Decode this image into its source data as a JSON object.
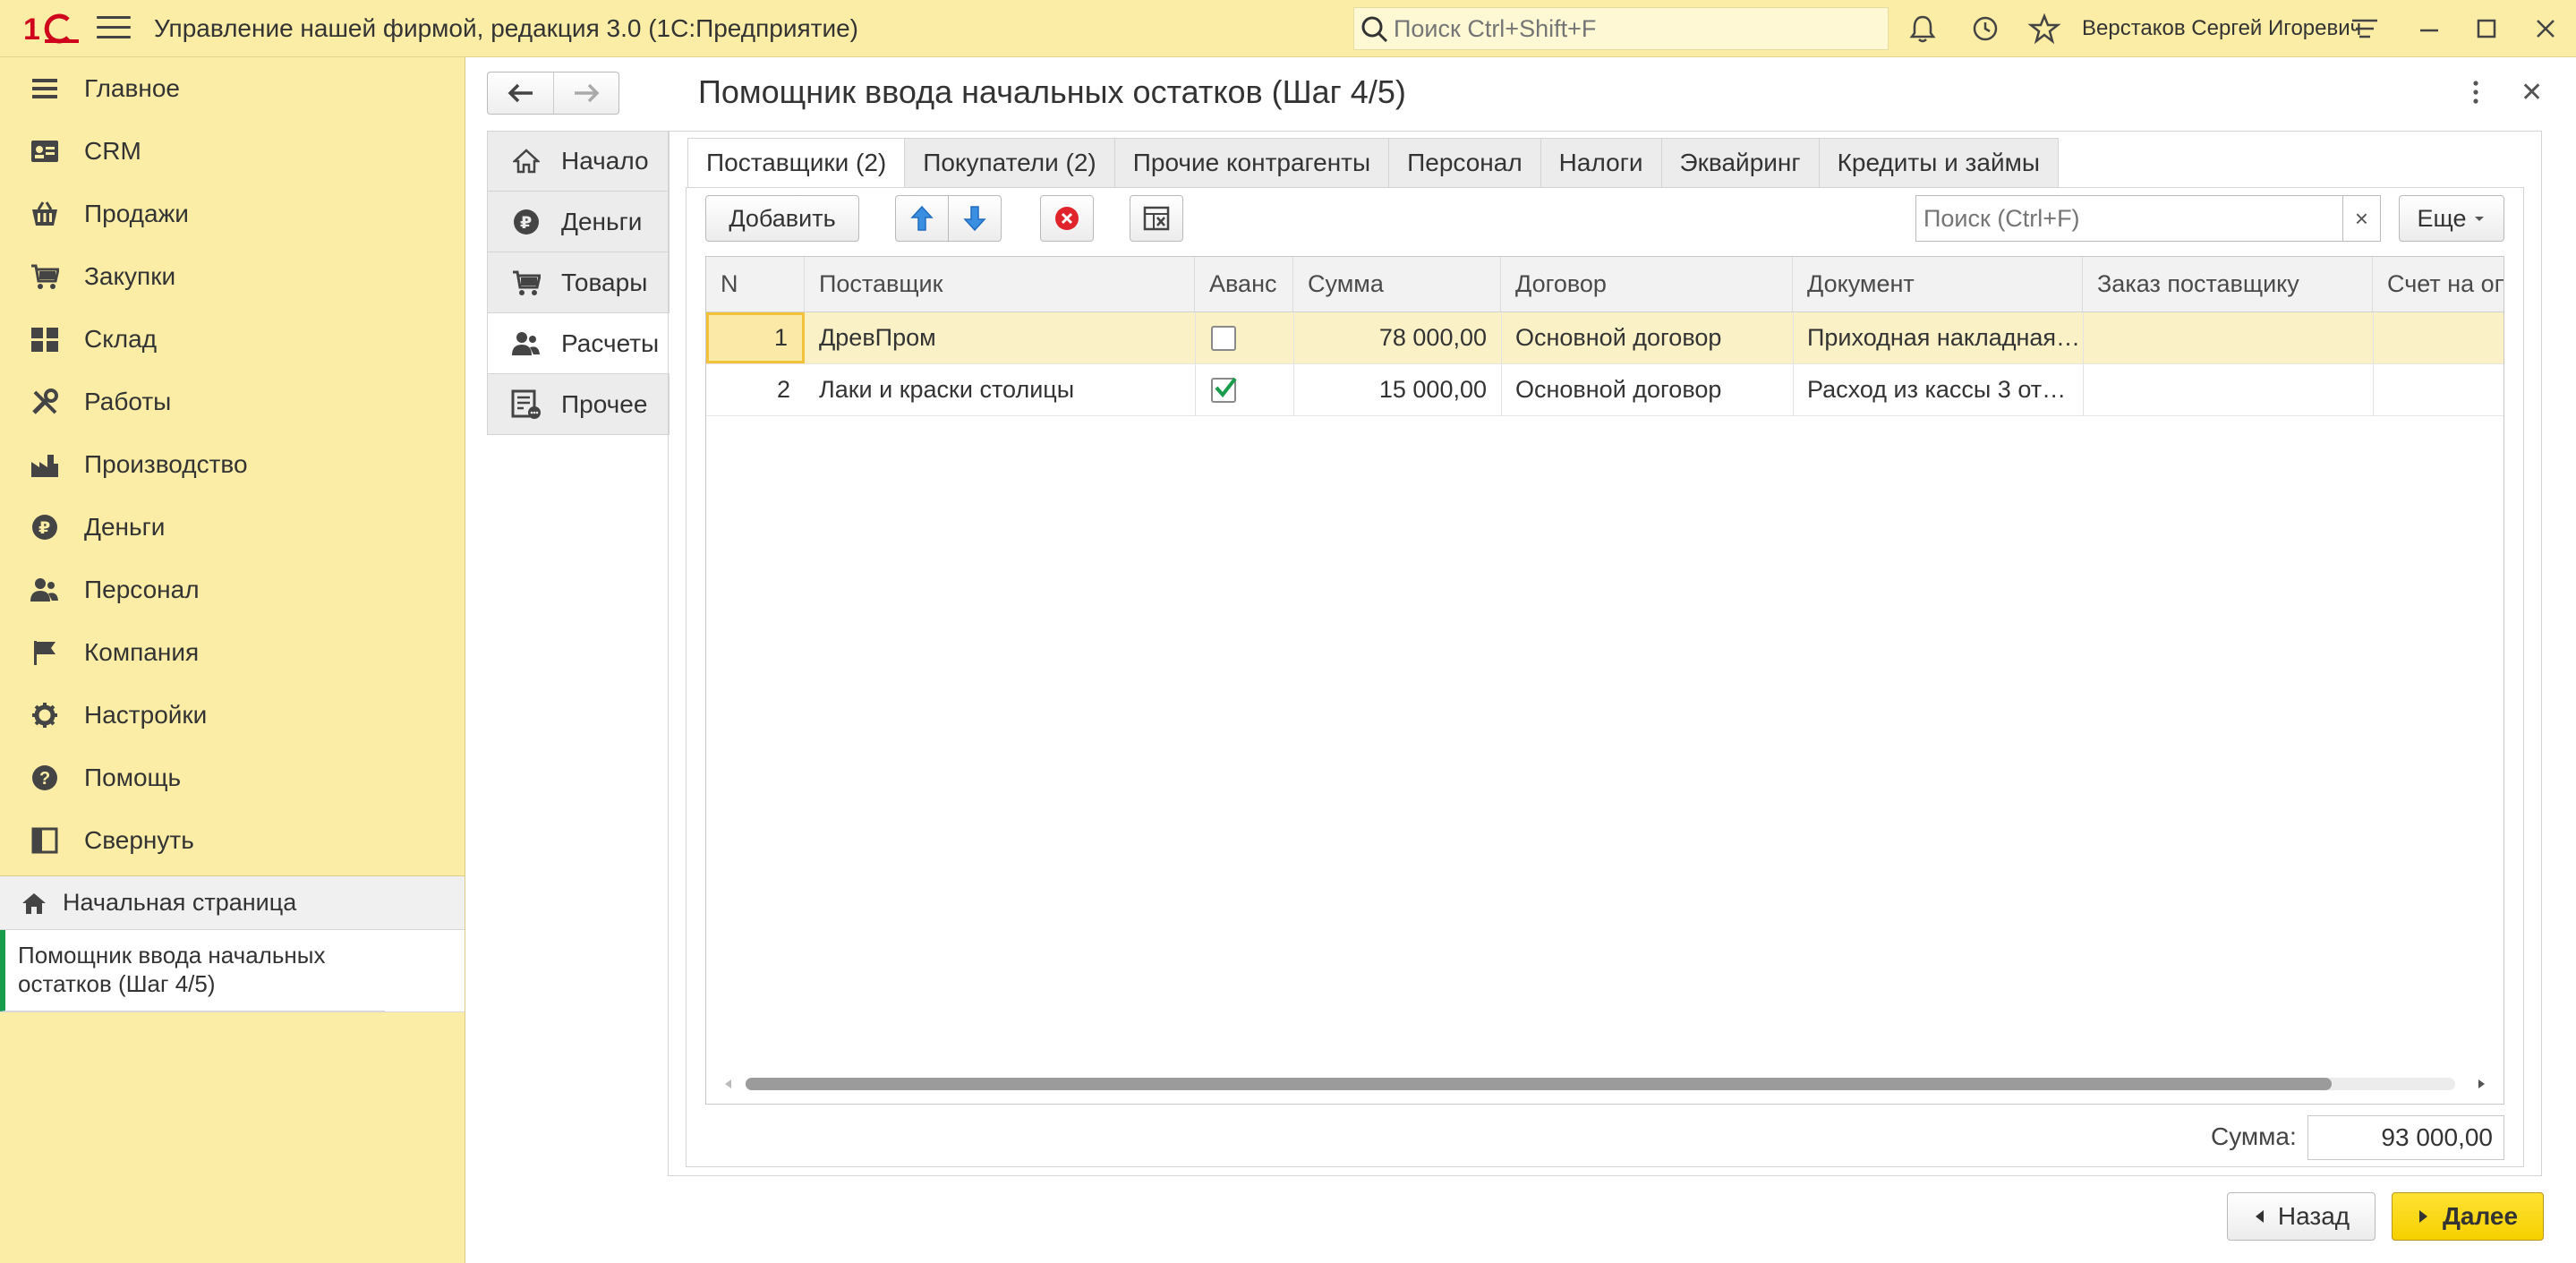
{
  "app": {
    "title": "Управление нашей фирмой, редакция 3.0  (1С:Предприятие)",
    "search_placeholder": "Поиск Ctrl+Shift+F",
    "user": "Верстаков Сергей Игоревич"
  },
  "sidebar": {
    "items": [
      {
        "label": "Главное",
        "icon": "list-icon"
      },
      {
        "label": "CRM",
        "icon": "crm-card-icon"
      },
      {
        "label": "Продажи",
        "icon": "basket-icon"
      },
      {
        "label": "Закупки",
        "icon": "cart-icon"
      },
      {
        "label": "Склад",
        "icon": "warehouse-icon"
      },
      {
        "label": "Работы",
        "icon": "tools-icon"
      },
      {
        "label": "Производство",
        "icon": "factory-icon"
      },
      {
        "label": "Деньги",
        "icon": "ruble-icon"
      },
      {
        "label": "Персонал",
        "icon": "people-icon"
      },
      {
        "label": "Компания",
        "icon": "flag-icon"
      },
      {
        "label": "Настройки",
        "icon": "gear-icon"
      },
      {
        "label": "Помощь",
        "icon": "help-icon"
      },
      {
        "label": "Свернуть",
        "icon": "collapse-icon"
      }
    ],
    "home": "Начальная страница",
    "open_window": "Помощник ввода начальных остатков (Шаг 4/5)"
  },
  "form": {
    "title": "Помощник ввода начальных остатков (Шаг 4/5)",
    "steps": [
      {
        "label": "Начало",
        "icon": "home-icon"
      },
      {
        "label": "Деньги",
        "icon": "ruble-icon"
      },
      {
        "label": "Товары",
        "icon": "cart-icon"
      },
      {
        "label": "Расчеты",
        "icon": "people-icon"
      },
      {
        "label": "Прочее",
        "icon": "document-icon"
      }
    ],
    "active_step": 3,
    "tabs": [
      "Поставщики (2)",
      "Покупатели (2)",
      "Прочие контрагенты",
      "Персонал",
      "Налоги",
      "Эквайринг",
      "Кредиты и займы"
    ],
    "active_tab": 0,
    "toolbar": {
      "add": "Добавить",
      "search_placeholder": "Поиск (Ctrl+F)",
      "clear": "×",
      "more": "Еще"
    },
    "table": {
      "columns": [
        "N",
        "Поставщик",
        "Аванс",
        "Сумма",
        "Договор",
        "Документ",
        "Заказ поставщику",
        "Счет на оплату"
      ],
      "rows": [
        {
          "n": "1",
          "supplier": "ДревПром",
          "advance": false,
          "sum": "78 000,00",
          "contract": "Основной договор",
          "document": "Приходная накладная",
          "order": "",
          "invoice": ""
        },
        {
          "n": "2",
          "supplier": "Лаки и краски столицы",
          "advance": true,
          "sum": "15 000,00",
          "contract": "Основной договор",
          "document": "Расход из кассы 3 от",
          "order": "",
          "invoice": ""
        }
      ]
    },
    "total_label": "Сумма:",
    "total_value": "93 000,00",
    "back": "Назад",
    "next": "Далее"
  },
  "colors": {
    "sidebar_bg": "#fbeda6",
    "accent_yellow": "#f6d000",
    "selected_row": "#fbf1c6",
    "open_window_marker": "#1a9c4c"
  }
}
